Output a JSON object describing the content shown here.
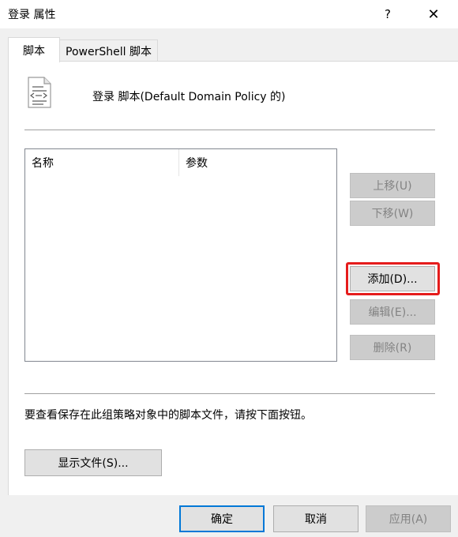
{
  "window": {
    "title": "登录 属性",
    "help_label": "?",
    "close_label": "✕"
  },
  "tabs": [
    {
      "label": "脚本",
      "active": true
    },
    {
      "label": "PowerShell 脚本",
      "active": false
    }
  ],
  "scripts_tab": {
    "header": "登录 脚本(Default Domain Policy 的)",
    "columns": [
      "名称",
      "参数"
    ],
    "rows": [],
    "buttons": {
      "move_up": "上移(U)",
      "move_down": "下移(W)",
      "add": "添加(D)...",
      "edit": "编辑(E)...",
      "delete": "删除(R)"
    },
    "info": "要查看保存在此组策略对象中的脚本文件，请按下面按钮。",
    "show_files": "显示文件(S)..."
  },
  "footer": {
    "ok": "确定",
    "cancel": "取消",
    "apply": "应用(A)"
  },
  "colors": {
    "highlight": "#e51c1c",
    "default_button_border": "#0078d7"
  },
  "icons": {
    "script": "script-document-icon"
  }
}
